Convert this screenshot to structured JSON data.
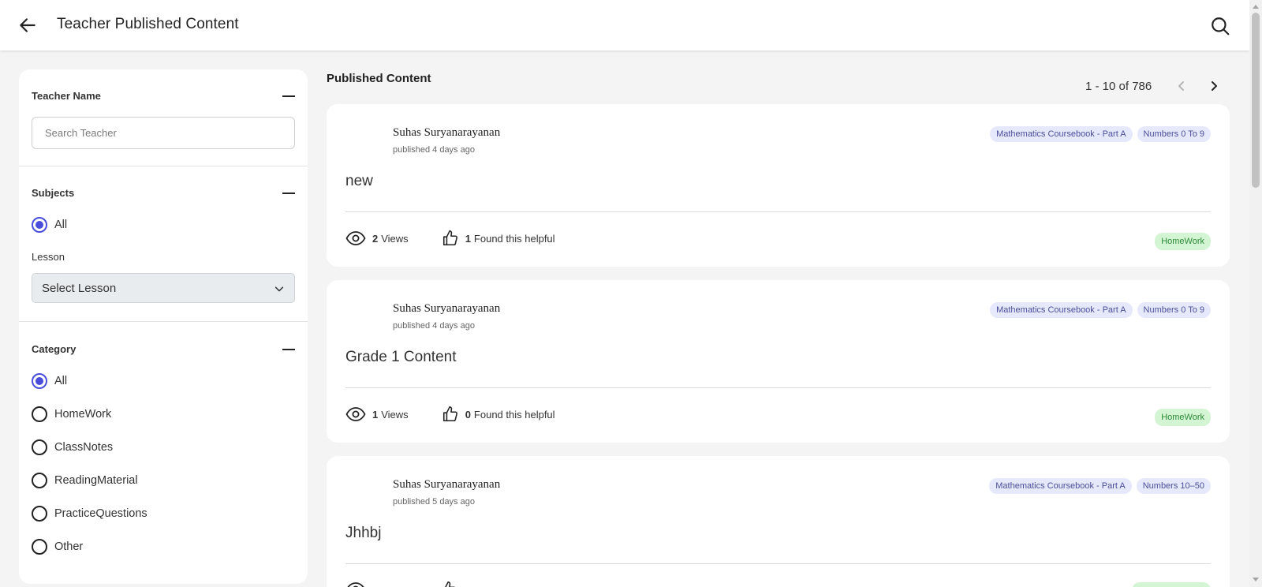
{
  "header": {
    "title": "Teacher Published Content"
  },
  "sidebar": {
    "teacher": {
      "heading": "Teacher Name",
      "placeholder": "Search Teacher"
    },
    "subjects": {
      "heading": "Subjects",
      "options": [
        "All"
      ],
      "lesson_label": "Lesson",
      "lesson_select": "Select Lesson"
    },
    "category": {
      "heading": "Category",
      "options": [
        "All",
        "HomeWork",
        "ClassNotes",
        "ReadingMaterial",
        "PracticeQuestions",
        "Other"
      ],
      "selected": "All"
    }
  },
  "main": {
    "heading": "Published Content",
    "pagination": "1 - 10 of 786",
    "cards": [
      {
        "author": "Suhas Suryanarayanan",
        "published": "published 4 days ago",
        "tags": [
          "Mathematics Coursebook - Part A",
          "Numbers 0 To 9"
        ],
        "title": "new",
        "views": "2",
        "views_label": "Views",
        "helpful": "1",
        "helpful_label": "Found this helpful",
        "category": "HomeWork"
      },
      {
        "author": "Suhas Suryanarayanan",
        "published": "published 4 days ago",
        "tags": [
          "Mathematics Coursebook - Part A",
          "Numbers 0 To 9"
        ],
        "title": "Grade 1 Content",
        "views": "1",
        "views_label": "Views",
        "helpful": "0",
        "helpful_label": "Found this helpful",
        "category": "HomeWork"
      },
      {
        "author": "Suhas Suryanarayanan",
        "published": "published 5 days ago",
        "tags": [
          "Mathematics Coursebook - Part A",
          "Numbers 10–50"
        ],
        "title": "Jhhbj",
        "views": "",
        "views_label": "",
        "helpful": "",
        "helpful_label": "",
        "category": ""
      }
    ]
  },
  "colors": {
    "accent": "#4a4ddb",
    "tag_bg": "#e6e8fb",
    "badge_bg": "#d4f5d4",
    "badge_text": "#2c8a39"
  },
  "icons": {
    "back": "arrow-left-icon",
    "search": "search-icon",
    "views": "eye-icon",
    "helpful": "thumbs-up-icon"
  }
}
